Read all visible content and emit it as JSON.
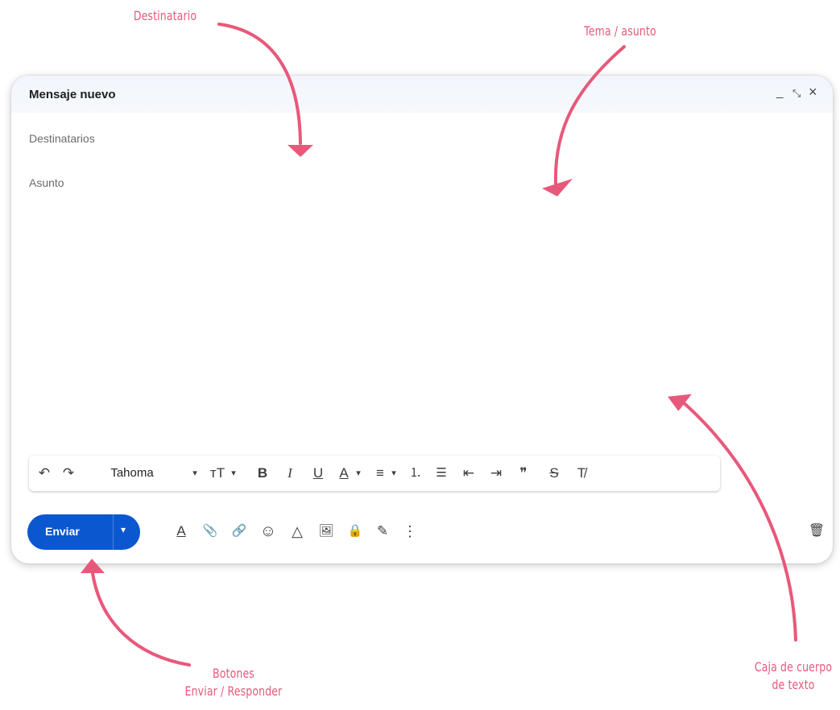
{
  "annotations": {
    "recipient": "Destinatario",
    "subject": "Tema / asunto",
    "buttons_line1": "Botones",
    "buttons_line2": "Enviar / Responder",
    "body_line1": "Caja de cuerpo",
    "body_line2": "de texto",
    "color": "#e8587a"
  },
  "compose": {
    "title": "Mensaje nuevo",
    "window_controls": [
      "_",
      "⤡",
      "×"
    ],
    "recipients_placeholder": "Destinatarios",
    "subject_placeholder": "Asunto",
    "body_text": ""
  },
  "formatting_toolbar": {
    "undo": "↶",
    "redo": "↷",
    "font": "Tahoma",
    "font_caret": "▾",
    "size": "тT",
    "size_caret": "▾",
    "bold": "B",
    "italic": "I",
    "underline": "U",
    "text_color": "A",
    "text_color_caret": "▾",
    "align": "≡",
    "align_caret": "▾",
    "numbered_list": "⒈",
    "bulleted_list": "☰",
    "indent_less": "⇤",
    "indent_more": "⇥",
    "quote": "❞",
    "strikethrough": "S",
    "clear_formatting": "T̸"
  },
  "bottom_bar": {
    "send_label": "Enviar",
    "send_caret": "▾",
    "send_color": "#0b57d0",
    "formatting_options": "A",
    "attach": "📎",
    "link": "🔗",
    "emoji": "☺",
    "drive": "△",
    "photo": "🖼",
    "confidential": "🔒",
    "signature": "✎",
    "more": "⋮",
    "discard": "🗑"
  }
}
